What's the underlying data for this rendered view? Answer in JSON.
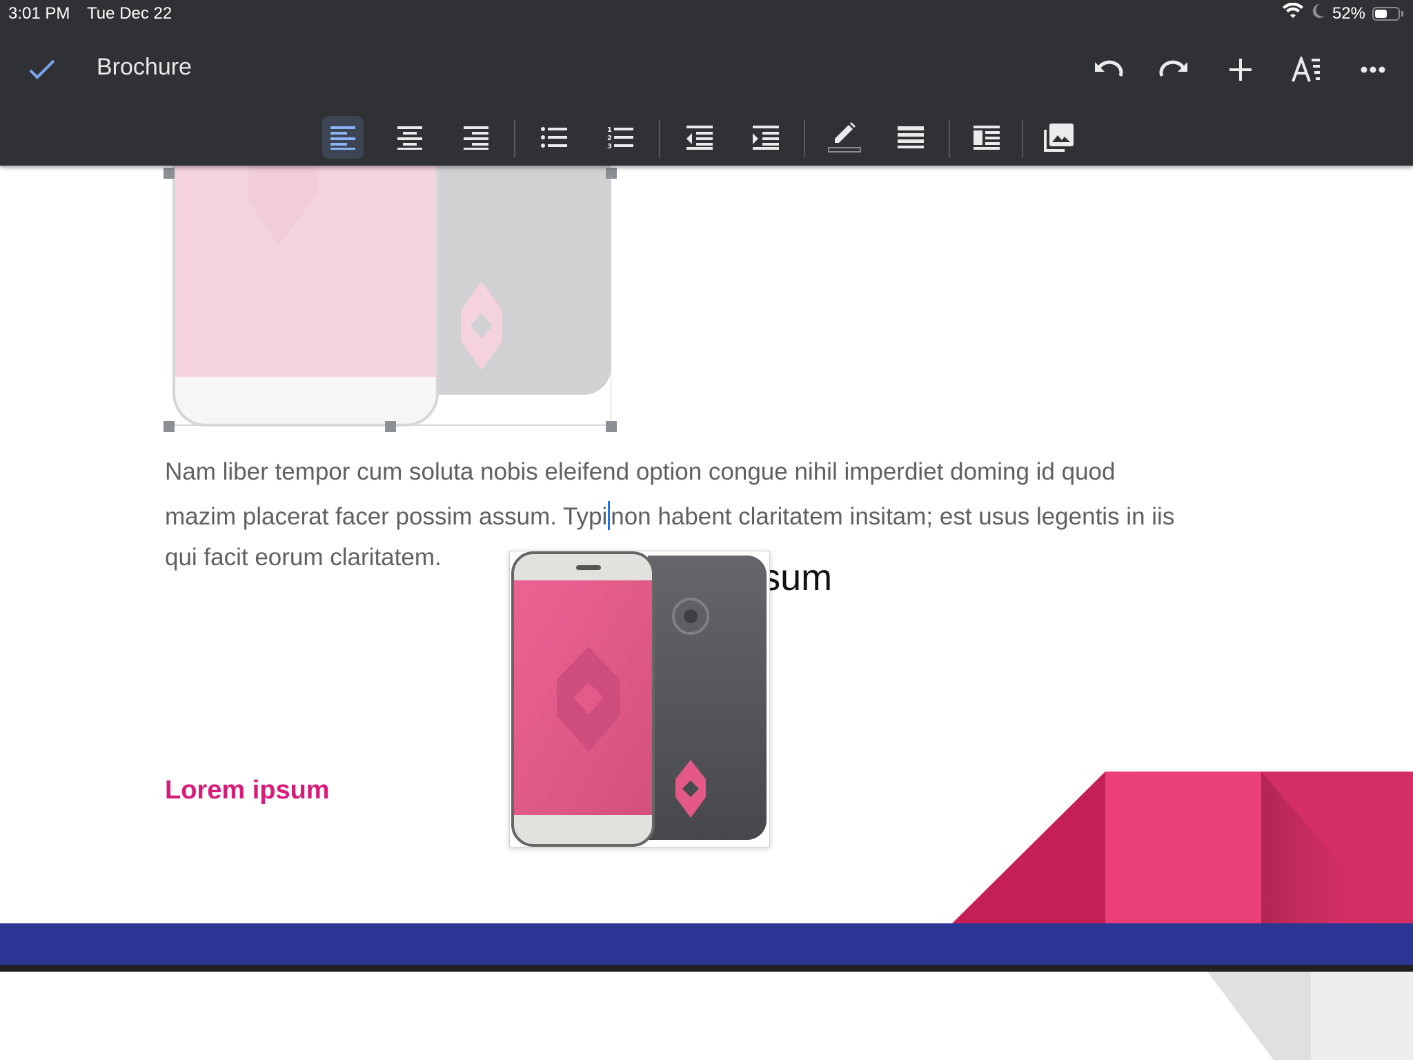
{
  "status_bar": {
    "time": "3:01 PM",
    "date": "Tue Dec 22",
    "battery_percent_label": "52%",
    "battery_level": 0.52,
    "icons": [
      "wifi-icon",
      "moon-icon",
      "battery-icon"
    ]
  },
  "header": {
    "done_icon": "check-icon",
    "title": "Brochure",
    "actions": [
      {
        "name": "undo",
        "icon": "undo-icon"
      },
      {
        "name": "redo",
        "icon": "redo-icon"
      },
      {
        "name": "insert",
        "icon": "plus-icon"
      },
      {
        "name": "text-format",
        "icon": "text-format-icon"
      },
      {
        "name": "more",
        "icon": "more-icon"
      }
    ]
  },
  "toolbar": {
    "items": [
      {
        "name": "align-left",
        "icon": "align-left-icon",
        "active": true
      },
      {
        "name": "align-center",
        "icon": "align-center-icon",
        "active": false
      },
      {
        "name": "align-right",
        "icon": "align-right-icon",
        "active": false
      },
      {
        "name": "bulleted-list",
        "icon": "bulleted-list-icon",
        "active": false
      },
      {
        "name": "numbered-list",
        "icon": "numbered-list-icon",
        "active": false
      },
      {
        "name": "decrease-indent",
        "icon": "decrease-indent-icon",
        "active": false
      },
      {
        "name": "increase-indent",
        "icon": "increase-indent-icon",
        "active": false
      },
      {
        "name": "highlight",
        "icon": "pencil-icon",
        "active": false
      },
      {
        "name": "line-spacing",
        "icon": "line-spacing-icon",
        "active": false
      },
      {
        "name": "text-wrap",
        "icon": "text-wrap-icon",
        "active": false
      },
      {
        "name": "image-options",
        "icon": "image-icon",
        "active": false
      }
    ]
  },
  "document": {
    "heading1": "Lorem ipsum",
    "paragraph_lines": [
      "Nam liber tempor cum soluta nobis eleifend option congue nihil imperdiet doming id quod",
      "mazim placerat facer possim assum. Typi",
      "non habent claritatem insitam; est usus legentis in iis",
      "qui facit eorum claritatem."
    ],
    "heading2": "Lorem ipsum",
    "colors": {
      "accent_pink": "#d81b7a",
      "band_blue": "#2b3594",
      "cursor_blue": "#1a73e8"
    }
  }
}
